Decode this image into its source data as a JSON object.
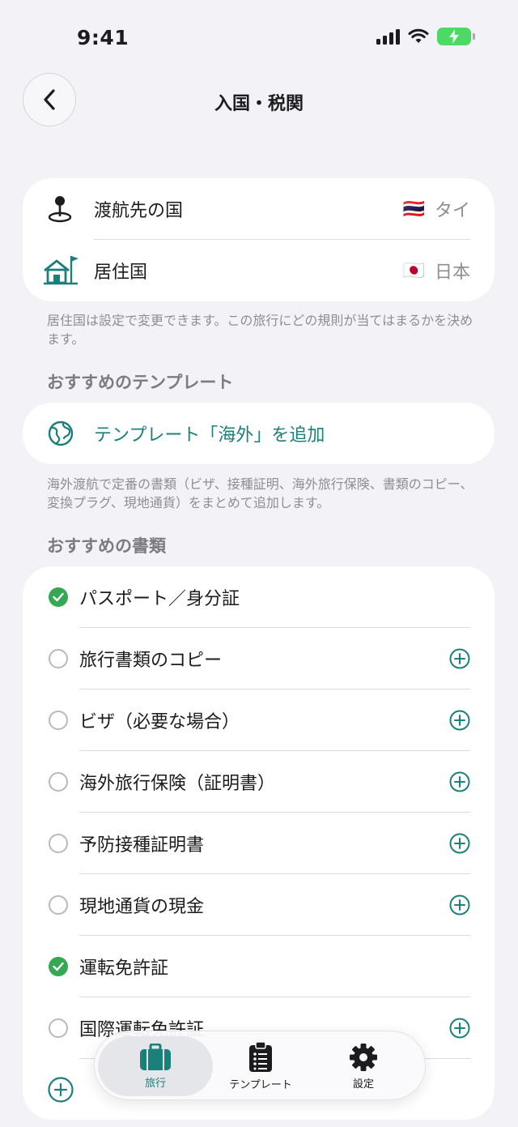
{
  "status_bar": {
    "time": "9:41"
  },
  "nav": {
    "title": "入国・税関"
  },
  "countries": {
    "destination": {
      "label": "渡航先の国",
      "flag": "🇹🇭",
      "value": "タイ"
    },
    "residence": {
      "label": "居住国",
      "flag": "🇯🇵",
      "value": "日本"
    }
  },
  "country_note": "居住国は設定で変更できます。この旅行にどの規則が当てはまるかを決めます。",
  "template_section": {
    "header": "おすすめのテンプレート",
    "button_label": "テンプレート「海外」を追加",
    "note": "海外渡航で定番の書類（ビザ、接種証明、海外旅行保険、書類のコピー、変換プラグ、現地通貨）をまとめて追加します。"
  },
  "documents_section": {
    "header": "おすすめの書類",
    "items": [
      {
        "label": "パスポート／身分証",
        "checked": true
      },
      {
        "label": "旅行書類のコピー",
        "checked": false
      },
      {
        "label": "ビザ（必要な場合）",
        "checked": false
      },
      {
        "label": "海外旅行保険（証明書）",
        "checked": false
      },
      {
        "label": "予防接種証明書",
        "checked": false
      },
      {
        "label": "現地通貨の現金",
        "checked": false
      },
      {
        "label": "運転免許証",
        "checked": true
      },
      {
        "label": "国際運転免許証",
        "checked": false
      }
    ]
  },
  "tab_bar": {
    "tabs": [
      {
        "label": "旅行",
        "icon": "suitcase-icon",
        "active": true
      },
      {
        "label": "テンプレート",
        "icon": "clipboard-list-icon",
        "active": false
      },
      {
        "label": "設定",
        "icon": "gear-icon",
        "active": false
      }
    ]
  },
  "colors": {
    "accent": "#1b7f7a",
    "check_green": "#34a853",
    "battery_green": "#4cd964",
    "background": "#f2f2f7"
  }
}
